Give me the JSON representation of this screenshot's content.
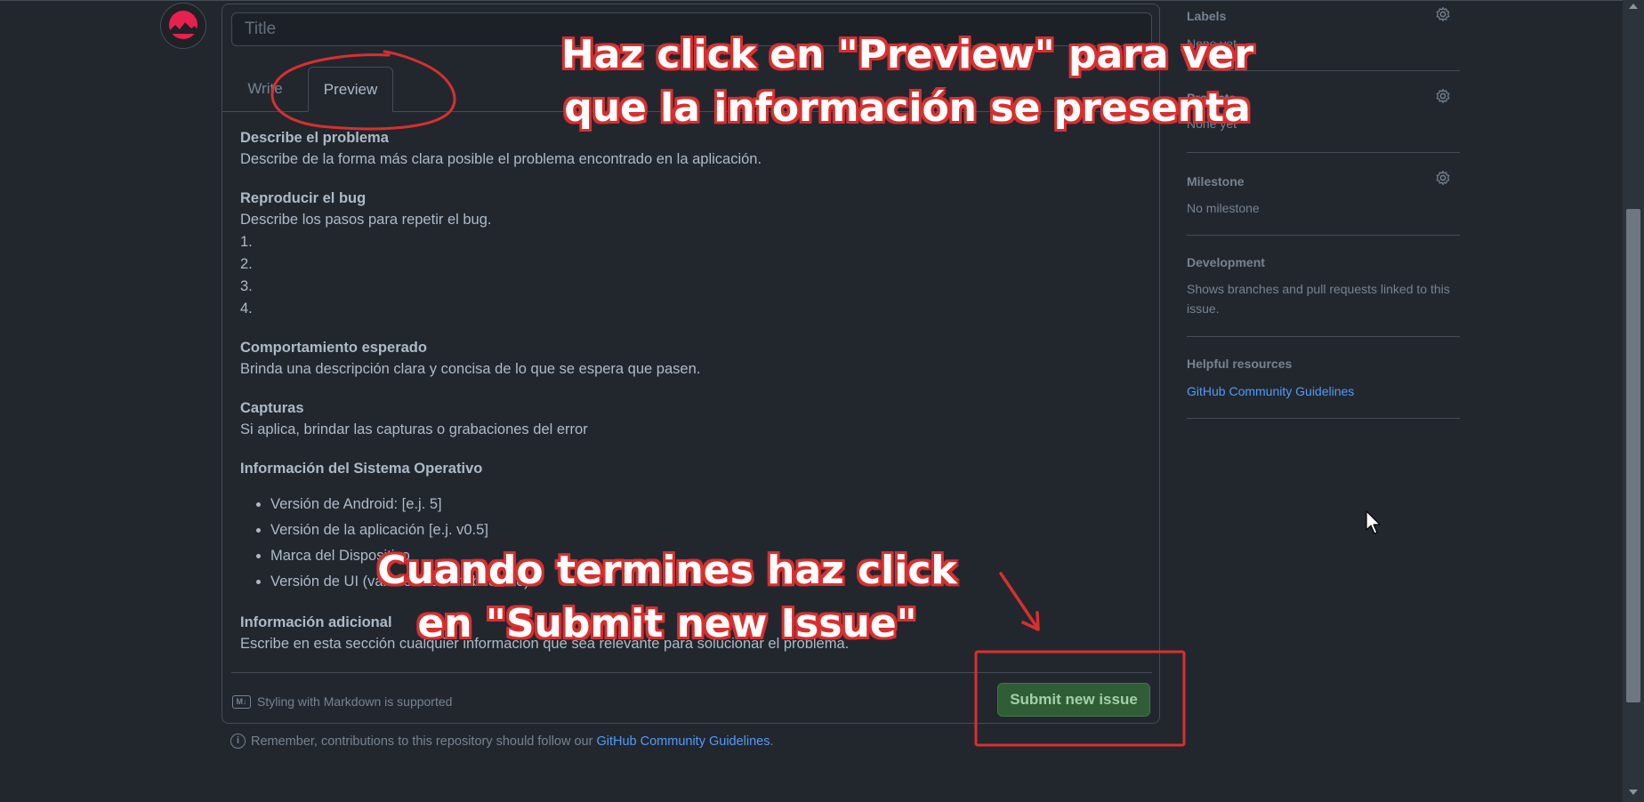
{
  "issue_form": {
    "title_placeholder": "Title",
    "tabs": {
      "write": "Write",
      "preview": "Preview",
      "active": "Preview"
    },
    "preview": {
      "problem_heading": "Describe el problema",
      "problem_text": "Describe de la forma más clara posible el problema encontrado en la aplicación.",
      "bug_heading": "Reproducir el bug",
      "bug_text": "Describe los pasos para repetir el bug.",
      "bug_steps": [
        "1.",
        "2.",
        "3.",
        "4."
      ],
      "expected_heading": "Comportamiento esperado",
      "expected_text": "Brinda una descripción clara y concisa de lo que se espera que pasen.",
      "captures_heading": "Capturas",
      "captures_text": "Si aplica, brindar las capturas o grabaciones del error",
      "os_heading": "Información del Sistema Operativo",
      "os_items": [
        "Versión de Android: [e.j. 5]",
        "Versión de la aplicación [e.j. v0.5]",
        "Marca del Dispositivo",
        "Versión de UI (varia en cada fabricante)"
      ],
      "additional_heading": "Información adicional",
      "additional_text": "Escribe en esta sección cualquier información que sea relevante para solucionar el problema."
    },
    "markdown_note": "Styling with Markdown is supported",
    "markdown_icon": "markdown-icon",
    "submit_label": "Submit new issue"
  },
  "footer": {
    "remember_text": "Remember, contributions to this repository should follow our ",
    "guidelines_link": "GitHub Community Guidelines",
    "period": "."
  },
  "sidebar": {
    "labels": {
      "title": "Labels",
      "value": "None yet"
    },
    "projects": {
      "title": "Projects",
      "value": "None yet"
    },
    "milestone": {
      "title": "Milestone",
      "value": "No milestone"
    },
    "development": {
      "title": "Development",
      "value": "Shows branches and pull requests linked to this issue."
    },
    "helpful": {
      "title": "Helpful resources",
      "link": "GitHub Community Guidelines"
    }
  },
  "annotations": {
    "top_line1": "Haz click en \"Preview\" para ver",
    "top_line2": "que la información se presenta",
    "bottom_line1": "Cuando termines haz click",
    "bottom_line2": "en \"Submit new Issue\""
  },
  "colors": {
    "background": "#22272e",
    "border": "#444c56",
    "link": "#539bf5",
    "submit": "#2f5d35",
    "annotation_red": "#d92f2f"
  }
}
